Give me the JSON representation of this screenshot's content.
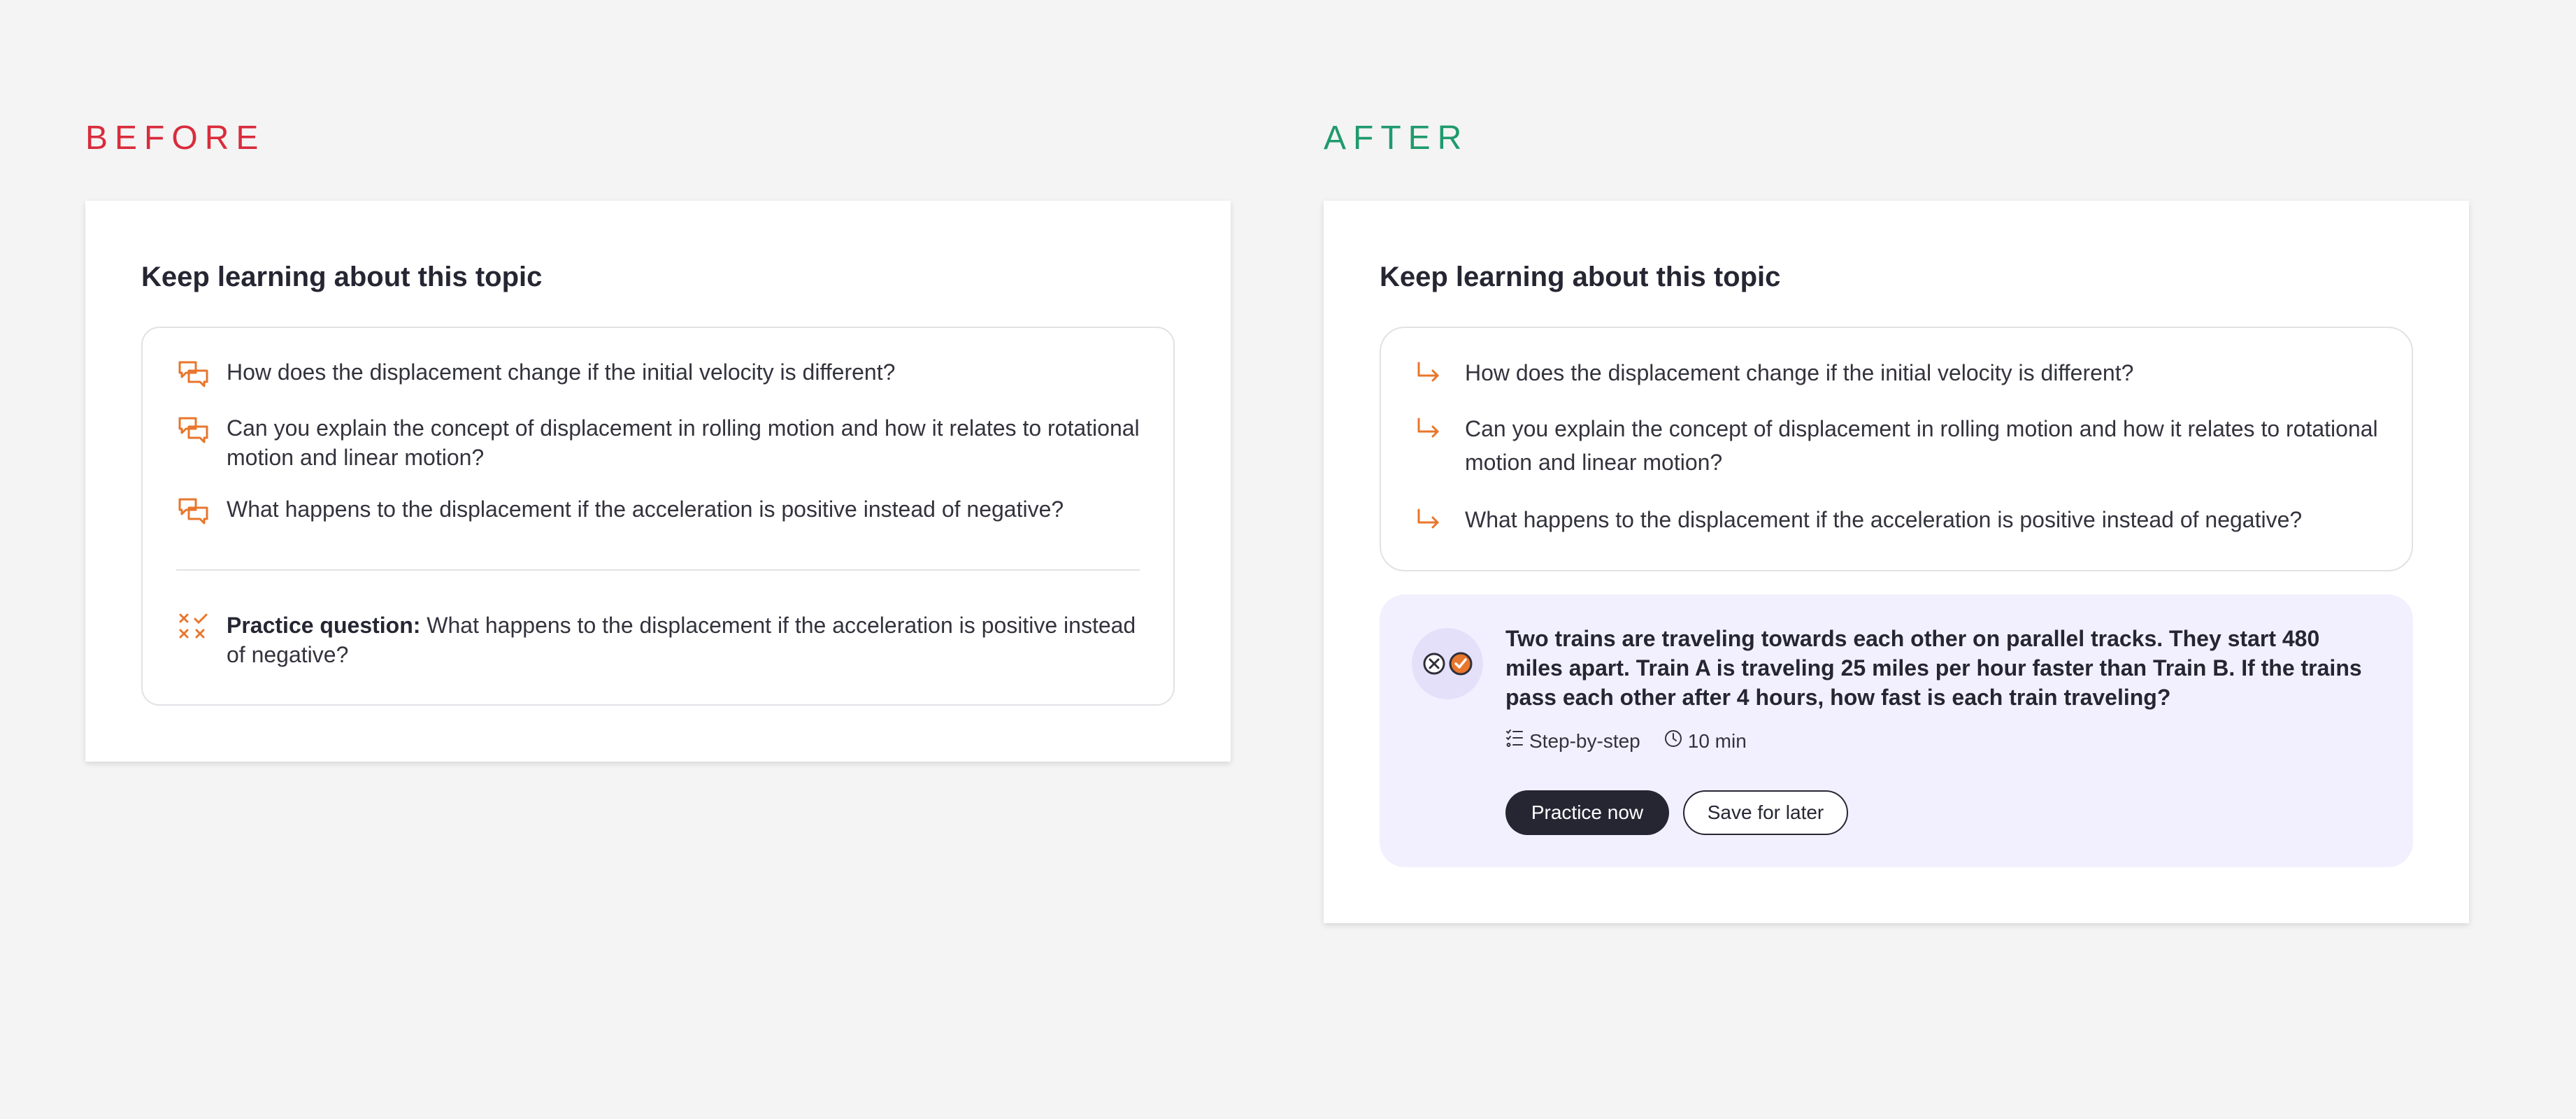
{
  "before": {
    "label": "BEFORE",
    "title": "Keep learning about this topic",
    "questions": [
      "How does the displacement change if the initial velocity is different?",
      "Can you explain the concept of displacement in rolling motion and how it relates to rotational motion and linear motion?",
      "What happens to the displacement if the acceleration is positive instead of negative?"
    ],
    "practice": {
      "prefix": "Practice question:",
      "text": " What happens to the displacement if the acceleration is positive instead of negative?"
    },
    "icons": {
      "question": "chat-bubbles-icon",
      "practice": "cross-check-icon"
    },
    "accent_color": "#e8762c"
  },
  "after": {
    "label": "AFTER",
    "title": "Keep learning about this topic",
    "questions": [
      "How does the displacement change if the initial velocity is different?",
      "Can you explain the concept of displacement in rolling motion and how it relates to rotational motion and linear motion?",
      "What happens to the displacement if the acceleration is positive instead of negative?"
    ],
    "icons": {
      "question": "arrow-turn-right-icon",
      "practice": "wrong-right-icon"
    },
    "practice_card": {
      "question": "Two trains are traveling towards each other on parallel tracks. They start 480 miles apart. Train A is traveling 25 miles per hour faster than Train B. If the trains pass each other after 4 hours, how fast is each train traveling?",
      "meta_type": "Step-by-step",
      "meta_time": "10 min",
      "primary_button": "Practice now",
      "secondary_button": "Save for later",
      "background_color": "#f2f0fe"
    }
  },
  "colors": {
    "before_label": "#d92c3c",
    "after_label": "#1f9a6d",
    "accent": "#e8762c",
    "dark": "#262633"
  }
}
